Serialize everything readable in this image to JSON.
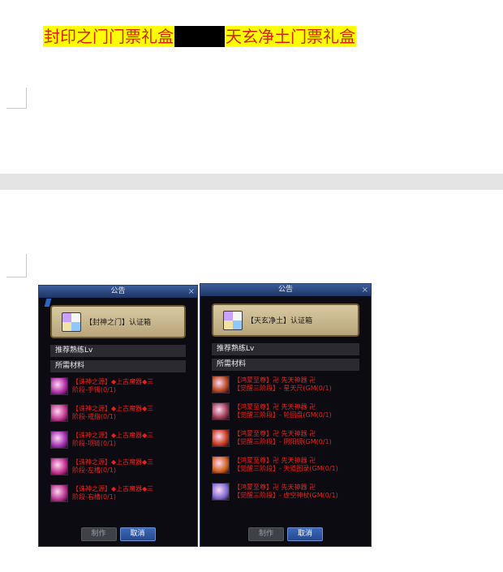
{
  "headline": {
    "left": "封印之门门票礼盒",
    "right": "天玄净土门票礼盒"
  },
  "panels": [
    {
      "title": "公告",
      "close": "×",
      "banner": "【封神之门】认证箱",
      "recommend": "推荐熟练Lv",
      "materials": "所需材料",
      "items": [
        {
          "text": "【诛神之源】◆上古魔器◆三\n阶段-手镯(0/1)",
          "color": "#b02aa6"
        },
        {
          "text": "【诛神之源】◆上古魔器◆三\n阶段-戒指(0/1)",
          "color": "#c0358d"
        },
        {
          "text": "【诛神之源】◆上古魔器◆三\n阶段-项链(0/1)",
          "color": "#a02fb0"
        },
        {
          "text": "【诛神之源】◆上古魔器◆三\n阶段-左槽(0/1)",
          "color": "#c22e8e"
        },
        {
          "text": "【诛神之源】◆上古魔器◆三\n阶段-右槽(0/1)",
          "color": "#b8318d"
        }
      ],
      "btn_make": "制作",
      "btn_cancel": "取消"
    },
    {
      "title": "公告",
      "close": "×",
      "banner": "【天玄净土】认证箱",
      "recommend": "推荐熟练Lv",
      "materials": "所需材料",
      "items": [
        {
          "text": "【鸿蒙至尊】卍 先天神器 卍\n【觉醒三阶段】- 星天尺(GM(0/1)",
          "color": "#b2461c"
        },
        {
          "text": "【鸿蒙至尊】卍 先天神器 卍\n【觉醒三阶段】- 轮回盘(GM(0/1)",
          "color": "#9c3a50"
        },
        {
          "text": "【鸿蒙至尊】卍 先天神器 卍\n【觉醒三阶段】- 阴阳镜(GM(0/1)",
          "color": "#c43a1a"
        },
        {
          "text": "【鸿蒙至尊】卍 先天神器 卍\n【觉醒三阶段】- 天道图录(GM(0/1)",
          "color": "#d0601a"
        },
        {
          "text": "【鸿蒙至尊】卍 先天神器 卍\n【觉醒三阶段】- 虚空神杖(GM(0/1)",
          "color": "#7a6ad0"
        }
      ],
      "btn_make": "制作",
      "btn_cancel": "取消"
    }
  ]
}
